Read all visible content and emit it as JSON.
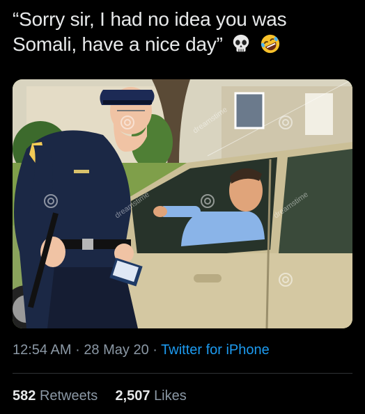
{
  "tweet": {
    "text": "“Sorry sir, I had no idea you was Somali, have a nice day”",
    "emojis": [
      "skull-emoji",
      "rofl-emoji"
    ]
  },
  "media": {
    "watermark": "dreamstime",
    "description_icons": [
      "police-officer",
      "car",
      "driver"
    ]
  },
  "meta": {
    "time": "12:54 AM",
    "separator": "·",
    "date": "28 May 20",
    "source": "Twitter for iPhone"
  },
  "stats": {
    "retweets_count": "582",
    "retweets_label": "Retweets",
    "likes_count": "2,507",
    "likes_label": "Likes"
  },
  "colors": {
    "background": "#000000",
    "text": "#e7e9ea",
    "muted": "#8b98a5",
    "link": "#1d9bf0"
  }
}
